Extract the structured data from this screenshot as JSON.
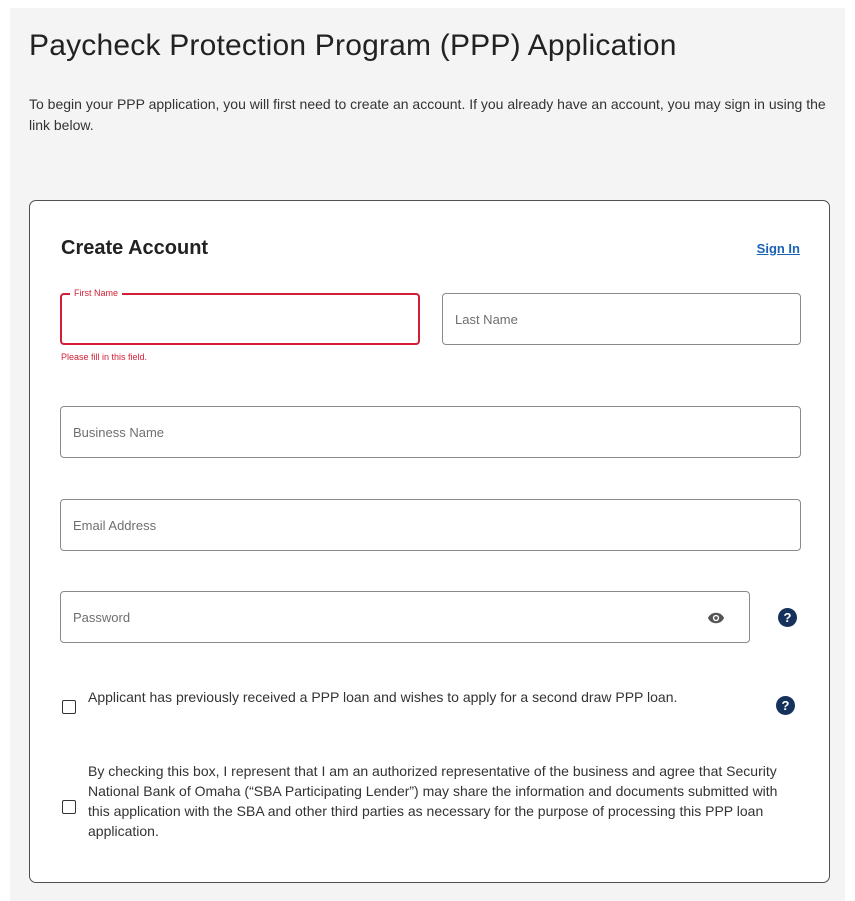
{
  "page": {
    "title": "Paycheck Protection Program (PPP) Application",
    "intro": "To begin your PPP application, you will first need to create an account. If you already have an account, you may sign in using the link below."
  },
  "form": {
    "title": "Create Account",
    "sign_in_label": "Sign In",
    "first_name": {
      "label": "First Name",
      "value": "",
      "error": "Please fill in this field."
    },
    "last_name": {
      "placeholder": "Last Name",
      "value": ""
    },
    "business_name": {
      "placeholder": "Business Name",
      "value": ""
    },
    "email": {
      "placeholder": "Email Address",
      "value": ""
    },
    "password": {
      "placeholder": "Password",
      "value": ""
    },
    "help_glyph": "?",
    "checkboxes": [
      {
        "label": "Applicant has previously received a PPP loan and wishes to apply for a second draw PPP loan.",
        "checked": false
      },
      {
        "label": "By checking this box, I represent that I am an authorized representative of the business and agree that Security National Bank of Omaha (“SBA Participating Lender”) may share the information and documents submitted with this application with the SBA and other third parties as necessary for the purpose of processing this PPP loan application.",
        "checked": false
      }
    ]
  },
  "icons": {
    "password_toggle": "eye-icon",
    "help": "help-circle-icon"
  },
  "colors": {
    "error": "#d21f36",
    "link": "#1b63b5",
    "help_icon_bg": "#16325c",
    "page_bg": "#f4f4f5"
  }
}
